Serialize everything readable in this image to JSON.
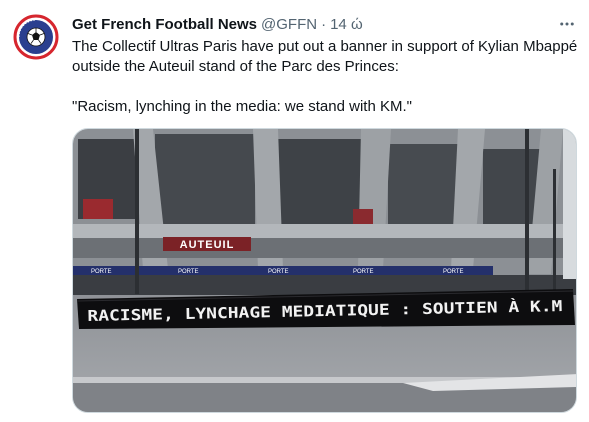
{
  "tweet": {
    "display_name": "Get French Football News",
    "handle": "@GFFN",
    "separator": "·",
    "timestamp": "14 ώ",
    "paragraphs": [
      "The Collectif Ultras Paris have put out a banner in support of Kylian Mbappé outside the Auteuil stand of the Parc des Princes:",
      "\"Racism, lynching in the media: we stand with KM.\""
    ],
    "avatar_icon": "gffn-logo-icon",
    "more_icon": "more-dots-icon"
  },
  "media": {
    "stand_sign": "AUTEUIL",
    "banner_text": "RACISME, LYNCHAGE MEDIATIQUE : SOUTIEN À K.M",
    "gate_label": "PORTE"
  },
  "colors": {
    "text": "#0f1419",
    "secondary": "#536471",
    "border": "#cfd9de",
    "brand_blue": "#2a3f8f",
    "brand_red": "#d6262e"
  }
}
